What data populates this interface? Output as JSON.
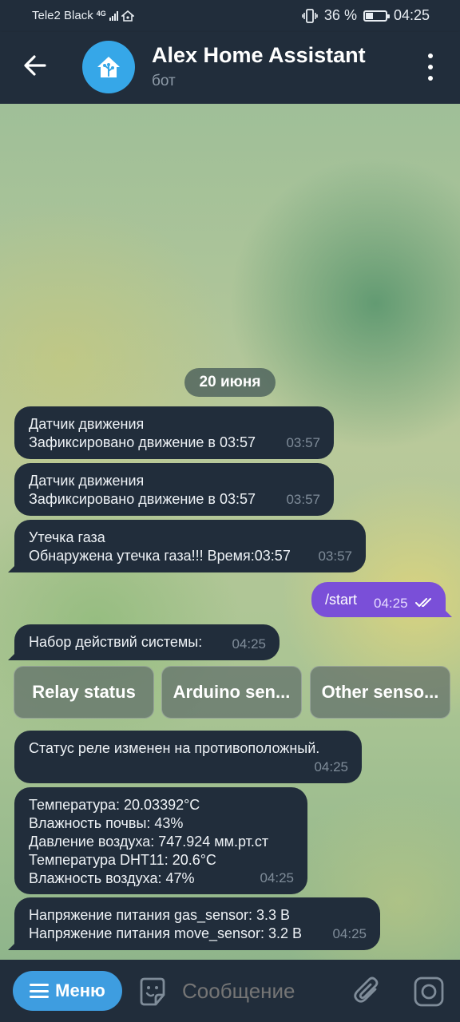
{
  "status_bar": {
    "carrier": "Tele2 Black",
    "network": "4G",
    "battery": "36 %",
    "battery_level": 0.36,
    "time": "04:25"
  },
  "header": {
    "title": "Alex Home Assistant",
    "subtitle": "бот"
  },
  "chat": {
    "date": "20 июня",
    "messages": [
      {
        "lines": [
          "Датчик движения",
          "Зафиксировано движение в 03:57"
        ],
        "time": "03:57"
      },
      {
        "lines": [
          "Датчик движения",
          "Зафиксировано движение в 03:57"
        ],
        "time": "03:57"
      },
      {
        "lines": [
          "Утечка газа",
          "Обнаружена утечка газа!!! Время:03:57"
        ],
        "time": "03:57"
      },
      {
        "text": "/start",
        "time": "04:25",
        "outgoing": true
      },
      {
        "lines": [
          "Набор действий системы:"
        ],
        "time": "04:25"
      },
      {
        "lines": [
          "Статус реле изменен на противоположный."
        ],
        "time": "04:25"
      },
      {
        "lines": [
          "Температура: 20.03392°C",
          "Влажность почвы: 43%",
          "Давление воздуха: 747.924 мм.рт.ст",
          "Температура DHT11: 20.6°C",
          "Влажность воздуха: 47%"
        ],
        "time": "04:25"
      },
      {
        "lines": [
          "Напряжение питания gas_sensor: 3.3 В",
          "Напряжение питания move_sensor: 3.2 В"
        ],
        "time": "04:25"
      }
    ],
    "keyboard_buttons": [
      "Relay status",
      "Arduino sen...",
      "Other senso..."
    ]
  },
  "bottom_bar": {
    "menu_label": "Меню",
    "input_placeholder": "Сообщение"
  },
  "colors": {
    "bar_bg": "#212d3b",
    "bubble_bg": "#212d3b",
    "outgoing_bg": "#7a4fd8",
    "menu_btn": "#3e9de0",
    "avatar_bg": "#36a7e8"
  }
}
